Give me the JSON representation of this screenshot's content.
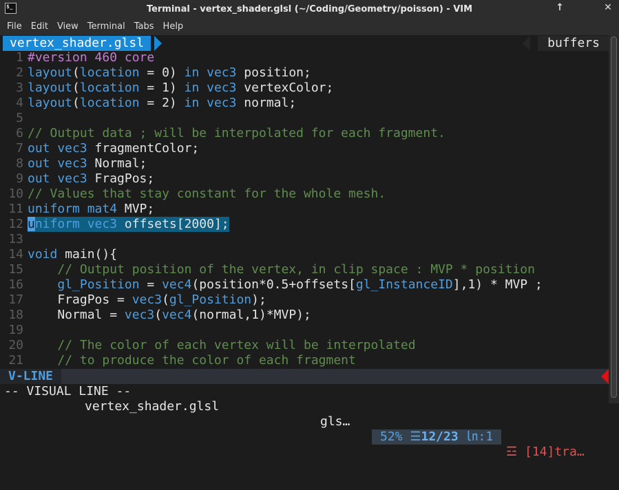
{
  "window": {
    "title": "Terminal - vertex_shader.glsl (~/Coding/Geometry/poisson) - VIM",
    "buttons": [
      "↑",
      "✕"
    ]
  },
  "menu": [
    "File",
    "Edit",
    "View",
    "Terminal",
    "Tabs",
    "Help"
  ],
  "tabline": {
    "active": "vertex_shader.glsl",
    "right": "buffers"
  },
  "code": [
    {
      "n": "1",
      "seg": [
        [
          "pp",
          "#version 460 core"
        ]
      ]
    },
    {
      "n": "2",
      "seg": [
        [
          "kw",
          "layout"
        ],
        [
          "t",
          "("
        ],
        [
          "kw",
          "location"
        ],
        [
          "t",
          " = 0) "
        ],
        [
          "kw",
          "in vec3"
        ],
        [
          "t",
          " position;"
        ]
      ]
    },
    {
      "n": "3",
      "seg": [
        [
          "kw",
          "layout"
        ],
        [
          "t",
          "("
        ],
        [
          "kw",
          "location"
        ],
        [
          "t",
          " = 1) "
        ],
        [
          "kw",
          "in vec3"
        ],
        [
          "t",
          " vertexColor;"
        ]
      ]
    },
    {
      "n": "4",
      "seg": [
        [
          "kw",
          "layout"
        ],
        [
          "t",
          "("
        ],
        [
          "kw",
          "location"
        ],
        [
          "t",
          " = 2) "
        ],
        [
          "kw",
          "in vec3"
        ],
        [
          "t",
          " normal;"
        ]
      ]
    },
    {
      "n": "5",
      "seg": []
    },
    {
      "n": "6",
      "seg": [
        [
          "cm",
          "// Output data ; will be interpolated for each fragment."
        ]
      ]
    },
    {
      "n": "7",
      "seg": [
        [
          "kw",
          "out vec3"
        ],
        [
          "t",
          " fragmentColor;"
        ]
      ]
    },
    {
      "n": "8",
      "seg": [
        [
          "kw",
          "out vec3"
        ],
        [
          "t",
          " Normal;"
        ]
      ]
    },
    {
      "n": "9",
      "seg": [
        [
          "kw",
          "out vec3"
        ],
        [
          "t",
          " FragPos;"
        ]
      ]
    },
    {
      "n": "10",
      "seg": [
        [
          "cm",
          "// Values that stay constant for the whole mesh."
        ]
      ]
    },
    {
      "n": "11",
      "seg": [
        [
          "kw",
          "uniform mat4"
        ],
        [
          "t",
          " MVP;"
        ]
      ]
    },
    {
      "n": "12",
      "sel": true,
      "seg": [
        [
          "cursor",
          "u"
        ],
        [
          "kw",
          "niform vec3"
        ],
        [
          "t",
          " offsets[2000];"
        ]
      ]
    },
    {
      "n": "13",
      "seg": []
    },
    {
      "n": "14",
      "seg": [
        [
          "kw",
          "void"
        ],
        [
          "t",
          " main(){"
        ]
      ]
    },
    {
      "n": "15",
      "seg": [
        [
          "t",
          "    "
        ],
        [
          "cm",
          "// Output position of the vertex, in clip space : MVP * position"
        ]
      ]
    },
    {
      "n": "16",
      "seg": [
        [
          "t",
          "    "
        ],
        [
          "kw",
          "gl_Position"
        ],
        [
          "t",
          " = "
        ],
        [
          "kw",
          "vec4"
        ],
        [
          "t",
          "(position*0.5+offsets["
        ],
        [
          "kw",
          "gl_InstanceID"
        ],
        [
          "t",
          "],1) * MVP ;"
        ]
      ]
    },
    {
      "n": "17",
      "seg": [
        [
          "t",
          "    FragPos = "
        ],
        [
          "kw",
          "vec3"
        ],
        [
          "t",
          "("
        ],
        [
          "kw",
          "gl_Position"
        ],
        [
          "t",
          ");"
        ]
      ]
    },
    {
      "n": "18",
      "seg": [
        [
          "t",
          "    Normal = "
        ],
        [
          "kw",
          "vec3"
        ],
        [
          "t",
          "("
        ],
        [
          "kw",
          "vec4"
        ],
        [
          "t",
          "(normal,1)*MVP);"
        ]
      ]
    },
    {
      "n": "19",
      "seg": []
    },
    {
      "n": "20",
      "seg": [
        [
          "t",
          "    "
        ],
        [
          "cm",
          "// The color of each vertex will be interpolated"
        ]
      ]
    },
    {
      "n": "21",
      "seg": [
        [
          "t",
          "    "
        ],
        [
          "cm",
          "// to produce the color of each fragment"
        ]
      ]
    }
  ],
  "status": {
    "mode": "V-LINE",
    "file": "vertex_shader.glsl",
    "filetype": "gls…",
    "percent": "52%",
    "line_icon": "☰",
    "position": "12/23",
    "col_icon": "㏑",
    "column": ":1",
    "warn_icon": "☲",
    "warning": "[14]tra…"
  },
  "cmdline": "-- VISUAL LINE --"
}
